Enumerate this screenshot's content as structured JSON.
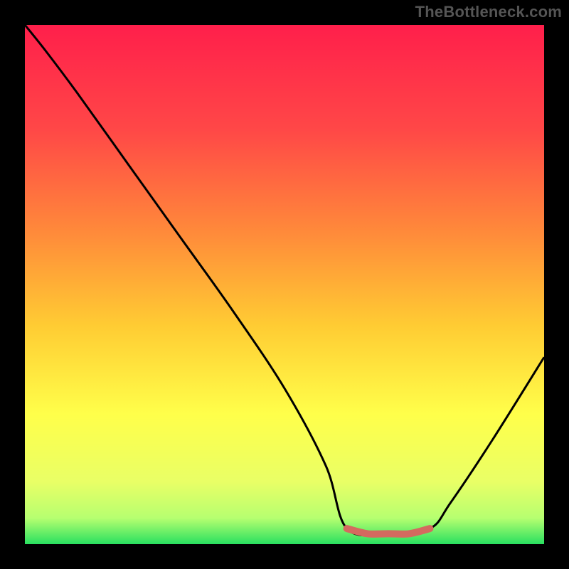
{
  "watermark": "TheBottleneck.com",
  "colors": {
    "background": "#000000",
    "watermark_text": "#555555",
    "curve": "#000000",
    "highlight": "#d46a5f",
    "gradient_stops": [
      {
        "offset": 0.0,
        "color": "#ff1f4b"
      },
      {
        "offset": 0.2,
        "color": "#ff4747"
      },
      {
        "offset": 0.4,
        "color": "#ff8a3a"
      },
      {
        "offset": 0.58,
        "color": "#ffcc33"
      },
      {
        "offset": 0.75,
        "color": "#ffff4a"
      },
      {
        "offset": 0.88,
        "color": "#e9ff66"
      },
      {
        "offset": 0.95,
        "color": "#b6ff70"
      },
      {
        "offset": 1.0,
        "color": "#29e060"
      }
    ]
  },
  "chart_data": {
    "type": "line",
    "title": "",
    "xlabel": "",
    "ylabel": "",
    "xlim": [
      0,
      100
    ],
    "ylim": [
      0,
      100
    ],
    "description": "Bottleneck-style curve: high on the left, descending to a flat minimum band around x≈62–78, then rising toward the right. Lower values are better (green zone).",
    "series": [
      {
        "name": "main-curve",
        "x": [
          0,
          4,
          10,
          20,
          30,
          40,
          50,
          58,
          62,
          70,
          78,
          82,
          90,
          100
        ],
        "y": [
          100,
          95,
          87,
          73,
          59,
          45,
          30,
          15,
          3,
          2,
          3,
          8,
          20,
          36
        ]
      },
      {
        "name": "optimal-highlight",
        "x": [
          62,
          66,
          70,
          74,
          78
        ],
        "y": [
          3,
          2,
          2,
          2,
          3
        ]
      }
    ]
  }
}
